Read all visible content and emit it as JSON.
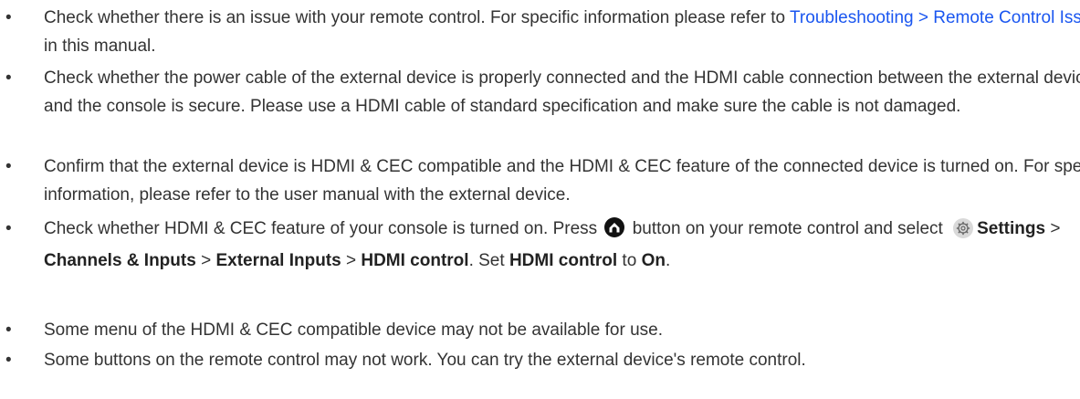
{
  "bullet_char": "•",
  "items": [
    {
      "text_before": "Check whether there is an issue with your remote control. For specific information please refer to ",
      "link": "Troubleshooting > Remote Control Issues",
      "text_after": " in this manual."
    },
    {
      "text": "Check whether the power cable of the external device is properly connected and the HDMI cable connection between the external device and the console is secure. Please use a HDMI cable of standard specification and make sure the cable is not damaged."
    },
    {
      "text": "Confirm that the external device is HDMI & CEC compatible and the HDMI & CEC feature of the connected device is turned on. For specific information, please refer to the user manual with the external device."
    },
    {
      "part1": "Check whether HDMI & CEC feature of your console is turned on. Press ",
      "part2": " button on your remote control and select ",
      "settings": "Settings",
      "sep": " > ",
      "channels_inputs": "Channels & Inputs",
      "external_inputs": "External Inputs",
      "hdmi_control": "HDMI control",
      "set_text": ". Set ",
      "to_text": " to ",
      "on": "On",
      "end": ".",
      "icons": [
        "home-icon",
        "gear-icon"
      ]
    },
    {
      "text": "Some menu of the HDMI & CEC compatible device may not be available for use."
    },
    {
      "text": "Some buttons on the remote control may not work. You can try the external device's remote control."
    }
  ],
  "colors": {
    "text": "#333333",
    "link": "#1a56f0",
    "icon_bg": "#d9d9d9"
  }
}
